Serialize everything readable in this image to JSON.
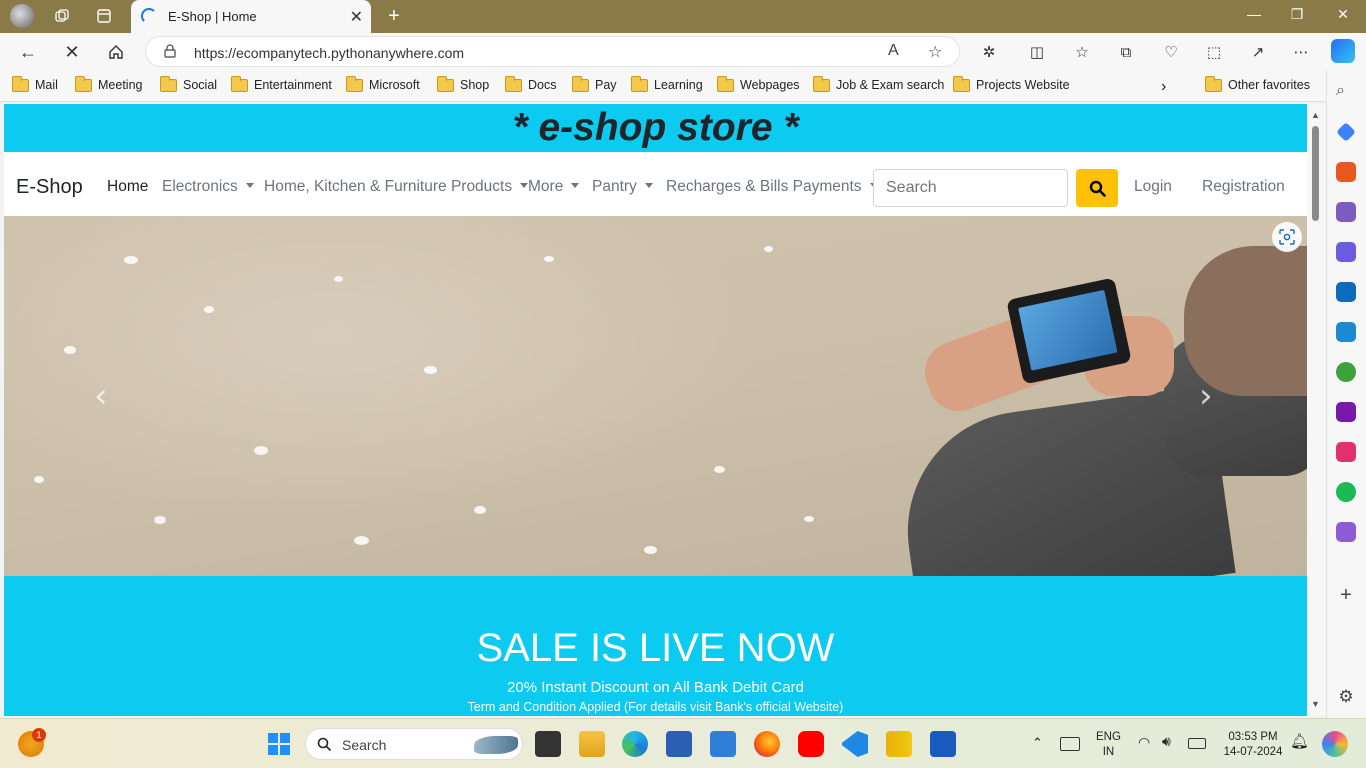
{
  "browser": {
    "tab_title": "E-Shop | Home",
    "url": "https://ecompanytech.pythonanywhere.com",
    "favorites": [
      "Mail",
      "Meeting",
      "Social",
      "Entertainment",
      "Microsoft",
      "Shop",
      "Docs",
      "Pay",
      "Learning",
      "Webpages",
      "Job & Exam search",
      "Projects Website"
    ],
    "other_favorites": "Other favorites"
  },
  "site": {
    "banner_title": "* e-shop store *",
    "brand": "E-Shop",
    "nav": {
      "home": "Home",
      "electronics": "Electronics",
      "home_kitchen": "Home, Kitchen & Furniture Products",
      "more": "More",
      "pantry": "Pantry",
      "recharges": "Recharges & Bills Payments"
    },
    "search_placeholder": "Search",
    "login": "Login",
    "registration": "Registration",
    "sale": {
      "heading": "SALE IS LIVE NOW",
      "line1": "20% Instant Discount on All Bank Debit Card",
      "line2": "Term and Condition Applied (For details visit Bank's official Website)"
    }
  },
  "taskbar": {
    "search_label": "Search",
    "notification_count": "1",
    "lang_top": "ENG",
    "lang_bottom": "IN",
    "time": "03:53 PM",
    "date": "14-07-2024"
  },
  "colors": {
    "accent_cyan": "#0dcaf0",
    "search_button": "#ffc107"
  }
}
